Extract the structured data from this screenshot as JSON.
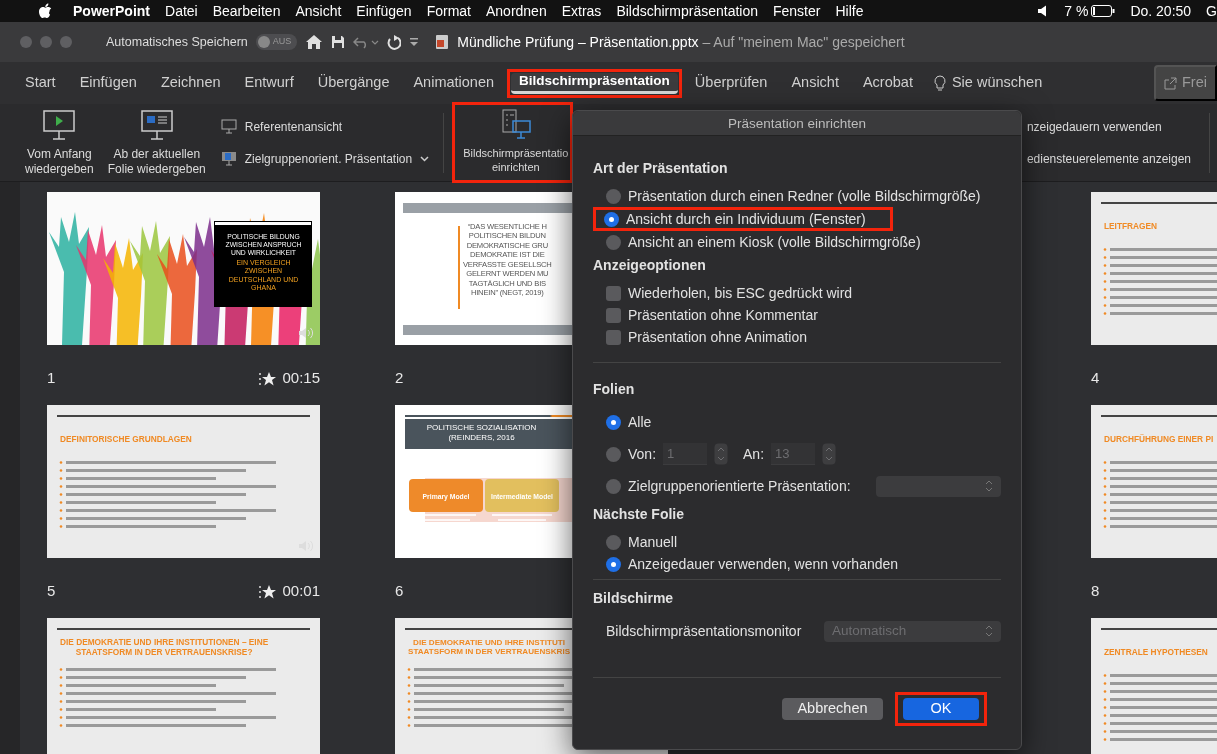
{
  "menu_bar": {
    "app": "PowerPoint",
    "items": [
      "Datei",
      "Bearbeiten",
      "Ansicht",
      "Einfügen",
      "Format",
      "Anordnen",
      "Extras",
      "Bildschirmpräsentation",
      "Fenster",
      "Hilfe"
    ],
    "battery": "7 %",
    "clock": "Do. 20:50",
    "user": "G"
  },
  "title_bar": {
    "autosave_label": "Automatisches Speichern",
    "autosave_toggle": {
      "label": "AUS",
      "on": false
    },
    "document": "Mündliche Prüfung – Präsentation.pptx",
    "location": " – Auf \"meinem Mac\" gespeichert"
  },
  "ribbon_tabs": [
    {
      "label": "Start",
      "selected": false,
      "highlighted": false
    },
    {
      "label": "Einfügen",
      "selected": false,
      "highlighted": false
    },
    {
      "label": "Zeichnen",
      "selected": false,
      "highlighted": false
    },
    {
      "label": "Entwurf",
      "selected": false,
      "highlighted": false
    },
    {
      "label": "Übergänge",
      "selected": false,
      "highlighted": false
    },
    {
      "label": "Animationen",
      "selected": false,
      "highlighted": false
    },
    {
      "label": "Bildschirmpräsentation",
      "selected": true,
      "highlighted": true
    },
    {
      "label": "Überprüfen",
      "selected": false,
      "highlighted": false
    },
    {
      "label": "Ansicht",
      "selected": false,
      "highlighted": false
    },
    {
      "label": "Acrobat",
      "selected": false,
      "highlighted": false
    }
  ],
  "tell_me": "Sie wünschen",
  "share": "Frei",
  "ribbon": [
    {
      "kind": "large",
      "lines": [
        "Vom Anfang",
        "wiedergeben"
      ],
      "highlighted": false
    },
    {
      "kind": "large",
      "lines": [
        "Ab der aktuellen",
        "Folie wiedergeben"
      ],
      "highlighted": false
    },
    {
      "kind": "stack",
      "items": [
        {
          "label": "Referentenansicht",
          "dropdown": false
        },
        {
          "label": "Zielgruppenorient. Präsentation",
          "dropdown": true
        }
      ]
    },
    {
      "kind": "large",
      "lines": [
        "Bildschirmpräsentatio",
        "einrichten"
      ],
      "highlighted": true
    },
    {
      "kind": "stack",
      "items": [
        {
          "label": "nzeigedauern verwenden",
          "dropdown": false
        },
        {
          "label": "ediensteuerelemente anzeigen",
          "dropdown": false
        }
      ]
    }
  ],
  "slides": [
    {
      "kind": "title-photo",
      "number": "1",
      "timing": "00:15",
      "audio": true,
      "title": "POLITISCHE BILDUNG ZWISCHEN ANSPRUCH UND WIRKLICHKEIT",
      "subtitle": "EIN VERGLEICH ZWISCHEN DEUTSCHLAND UND GHANA"
    },
    {
      "kind": "quote",
      "number": "2",
      "audio": false,
      "lines": [
        "“DAS WESENTLICHE H",
        "POLITISCHEN BILDUN",
        "DEMOKRATISCHE GRU",
        "DEMOKRATIE IST DIE",
        "VERFASSTE GESELLSCH",
        "GELERNT WERDEN MU",
        "TAGTÄGLICH UND BIS",
        "HINEIN” (NEGT, 2019)"
      ]
    },
    {
      "kind": "content",
      "number": "4",
      "audio": false,
      "title_lines": [
        "LEITFRAGEN"
      ]
    },
    {
      "kind": "content",
      "number": "5",
      "timing": "00:01",
      "audio": true,
      "title_lines": [
        "DEFINITORISCHE GRUNDLAGEN"
      ]
    },
    {
      "kind": "diagram",
      "number": "6",
      "audio": false,
      "title": "POLITISCHE SOZIALISATION (REINDERS, 2016",
      "boxes": [
        "Primary Model",
        "Intermediate Model"
      ]
    },
    {
      "kind": "content",
      "number": "8",
      "audio": false,
      "title_lines": [
        "DURCHFÜHRUNG EINER PI"
      ]
    },
    {
      "kind": "content",
      "audio": false,
      "title_lines": [
        "DIE DEMOKRATIE UND IHRE INSTITUTIONEN – EINE",
        "STAATSFORM IN DER VERTRAUENSKRISE?"
      ]
    },
    {
      "kind": "content",
      "audio": false,
      "title_lines": [
        "DIE DEMOKRATIE UND IHRE INSTITUTI",
        "STAATSFORM IN DER VERTRAUENSKRIS"
      ]
    },
    {
      "kind": "content",
      "audio": false,
      "title_lines": [
        "ZENTRALE HYPOTHESEN"
      ]
    }
  ],
  "dialog": {
    "title": "Präsentation einrichten",
    "sections": [
      {
        "kind": "radios",
        "heading": "Art der Präsentation",
        "divider_after": false,
        "options": [
          {
            "label": "Präsentation durch einen Redner (volle Bildschirmgröße)",
            "selected": false,
            "highlighted": false
          },
          {
            "label": "Ansicht durch ein Individuum (Fenster)",
            "selected": true,
            "highlighted": true
          },
          {
            "label": "Ansicht an einem Kiosk (volle Bildschirmgröße)",
            "selected": false,
            "highlighted": false
          }
        ]
      },
      {
        "kind": "checkboxes",
        "heading": "Anzeigeoptionen",
        "divider_after": true,
        "options": [
          {
            "label": "Wiederholen, bis ESC gedrückt wird",
            "checked": false
          },
          {
            "label": "Präsentation ohne Kommentar",
            "checked": false
          },
          {
            "label": "Präsentation ohne Animation",
            "checked": false
          }
        ]
      },
      {
        "kind": "slide-range",
        "heading": "Folien",
        "divider_after": false,
        "options": [
          {
            "kind": "plain",
            "label": "Alle",
            "selected": true
          },
          {
            "kind": "range",
            "label": "Von:",
            "selected": false,
            "from": "1",
            "to_label": "An:",
            "to": "13"
          },
          {
            "kind": "select",
            "label": "Zielgruppenorientierte Präsentation:",
            "selected": false
          }
        ]
      },
      {
        "kind": "radios",
        "heading": "Nächste Folie",
        "divider_after": true,
        "options": [
          {
            "label": "Manuell",
            "selected": false,
            "highlighted": false
          },
          {
            "label": "Anzeigedauer verwenden, wenn vorhanden",
            "selected": true,
            "highlighted": false
          }
        ]
      },
      {
        "kind": "select-row",
        "heading": "Bildschirme",
        "divider_after": true,
        "label": "Bildschirmpräsentationsmonitor",
        "value": "Automatisch",
        "disabled": true
      }
    ],
    "buttons": [
      {
        "label": "Abbrechen",
        "default": false,
        "highlighted": false
      },
      {
        "label": "OK",
        "default": true,
        "highlighted": true
      }
    ]
  }
}
